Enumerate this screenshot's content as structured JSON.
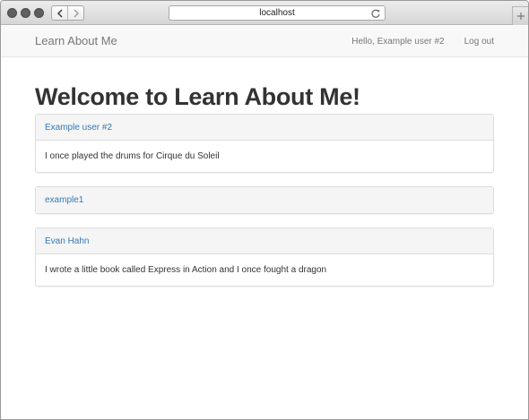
{
  "browser": {
    "address": "localhost"
  },
  "navbar": {
    "brand": "Learn About Me",
    "greeting": "Hello, Example user #2",
    "logout": "Log out"
  },
  "page": {
    "title": "Welcome to Learn About Me!"
  },
  "users": [
    {
      "name": "Example user #2",
      "bio": "I once played the drums for Cirque du Soleil"
    },
    {
      "name": "example1",
      "bio": ""
    },
    {
      "name": "Evan Hahn",
      "bio": "I wrote a little book called Express in Action and I once fought a dragon"
    }
  ],
  "colors": {
    "link": "#337ab7",
    "navbar_bg": "#f8f8f8",
    "panel_heading_bg": "#f5f5f5"
  }
}
